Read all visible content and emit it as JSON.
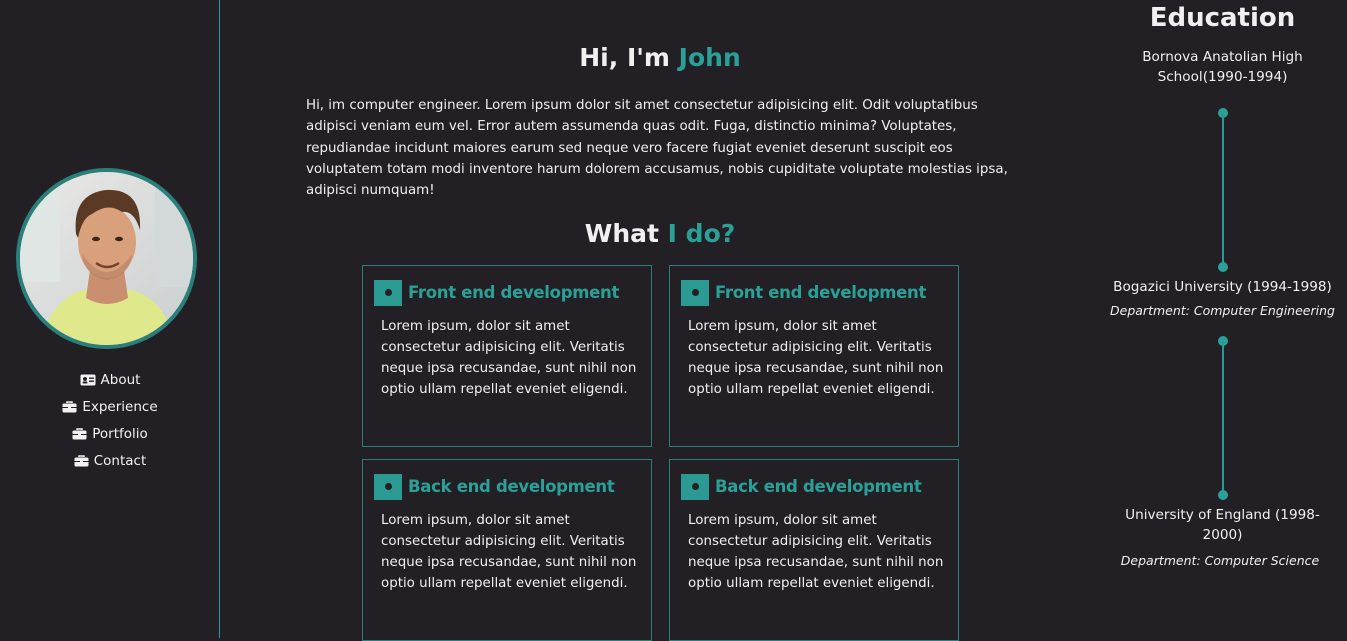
{
  "sidebar": {
    "nav": [
      {
        "label": "About",
        "icon": "id-card-icon"
      },
      {
        "label": "Experience",
        "icon": "briefcase-icon"
      },
      {
        "label": "Portfolio",
        "icon": "briefcase-icon"
      },
      {
        "label": "Contact",
        "icon": "briefcase-icon"
      }
    ]
  },
  "hero": {
    "greeting": "Hi, I'm",
    "name": "John",
    "intro": "Hi, im computer engineer. Lorem ipsum dolor sit amet consectetur adipisicing elit. Odit voluptatibus adipisci veniam eum vel. Error autem assumenda quas odit. Fuga, distinctio minima? Voluptates, repudiandae incidunt maiores earum sed neque vero facere fugiat eveniet deserunt suscipit eos voluptatem totam modi inventore harum dolorem accusamus, nobis cupiditate voluptate molestias ipsa, adipisci numquam!"
  },
  "services": {
    "title_prefix": "What",
    "title_accent": "I do?",
    "cards": [
      {
        "title": "Front end development",
        "text": "Lorem ipsum, dolor sit amet consectetur adipisicing elit. Veritatis neque ipsa recusandae, sunt nihil non optio ullam repellat eveniet eligendi."
      },
      {
        "title": "Front end development",
        "text": "Lorem ipsum, dolor sit amet consectetur adipisicing elit. Veritatis neque ipsa recusandae, sunt nihil non optio ullam repellat eveniet eligendi."
      },
      {
        "title": "Back end development",
        "text": "Lorem ipsum, dolor sit amet consectetur adipisicing elit. Veritatis neque ipsa recusandae, sunt nihil non optio ullam repellat eveniet eligendi."
      },
      {
        "title": "Back end development",
        "text": "Lorem ipsum, dolor sit amet consectetur adipisicing elit. Veritatis neque ipsa recusandae, sunt nihil non optio ullam repellat eveniet eligendi."
      }
    ]
  },
  "education": {
    "title": "Education",
    "items": [
      {
        "name": "Bornova Anatolian High School(1990-1994)",
        "department": ""
      },
      {
        "name": "Bogazici University (1994-1998)",
        "department": "Department: Computer Engineering"
      },
      {
        "name": "University of England (1998-2000)",
        "department": "Department: Computer Science"
      }
    ]
  },
  "colors": {
    "background": "#232025",
    "accent": "#2aa198",
    "border": "#2a7f7a",
    "text": "#f0f0f0"
  }
}
